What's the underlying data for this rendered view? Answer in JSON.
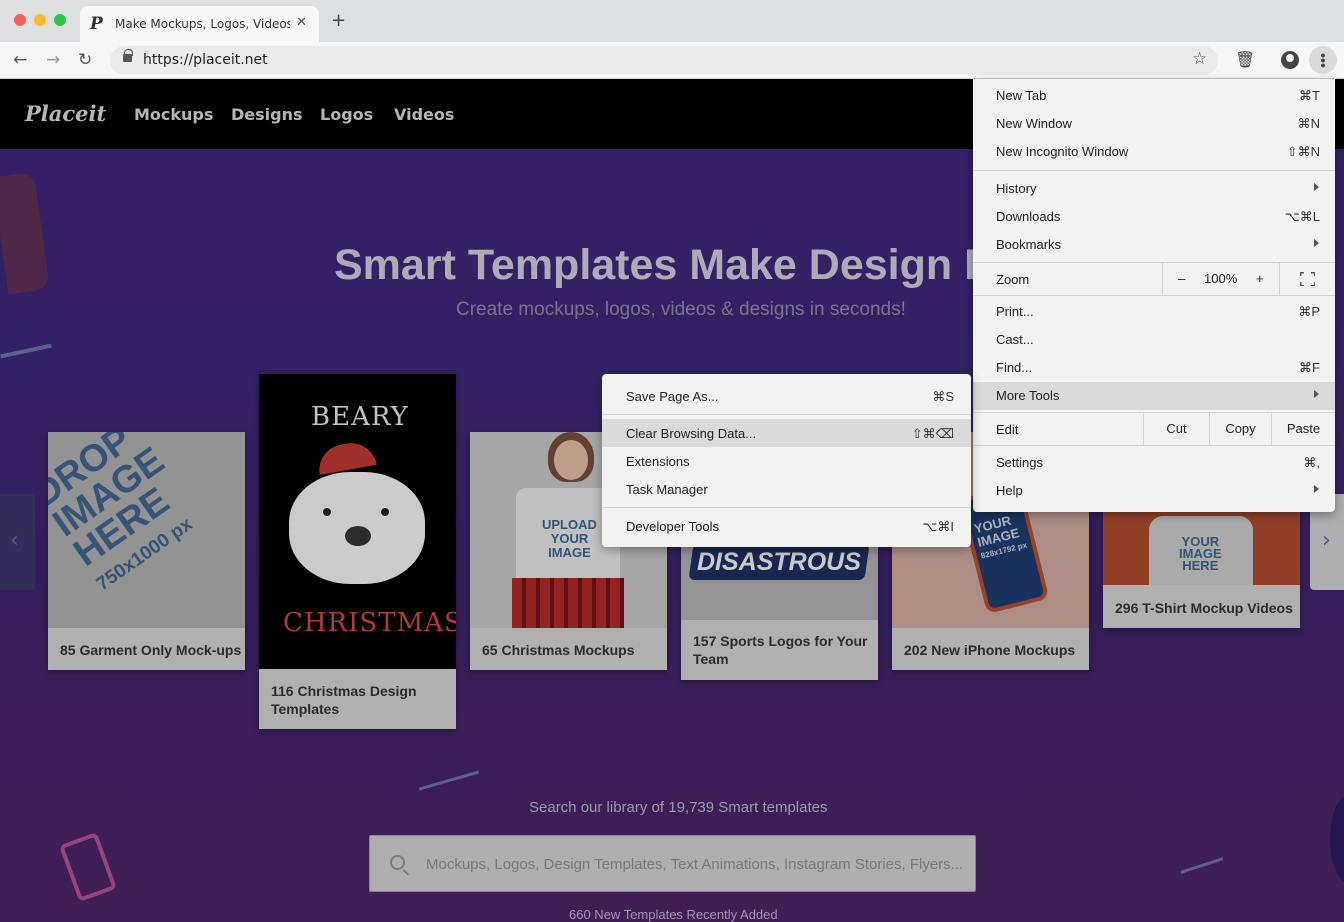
{
  "browser": {
    "tab_title": "Make Mockups, Logos, Videos",
    "tab_favicon": "P",
    "tab_close": "✕",
    "new_tab": "+",
    "url": "https://placeit.net",
    "icons": [
      "back-icon",
      "forward-icon",
      "reload-icon",
      "lock-icon",
      "star-icon",
      "trash-icon",
      "profile-icon",
      "menu-icon"
    ]
  },
  "site": {
    "logo": "Placeit",
    "nav": [
      "Mockups",
      "Designs",
      "Logos",
      "Videos"
    ],
    "hero_title": "Smart Templates Make Design Eas",
    "hero_subtitle": "Create mockups, logos, videos & designs in seconds!",
    "cards": [
      {
        "label": "85 Garment Only Mock-ups",
        "image_text": [
          "DROP",
          "IMAGE",
          "HERE",
          "750x1000 px"
        ]
      },
      {
        "label_line1": "116 Christmas Design",
        "label_line2": "Templates",
        "image_text": [
          "BEARY",
          "CHRISTMAS"
        ]
      },
      {
        "label": "65 Christmas Mockups",
        "image_text": [
          "UPLOAD",
          "YOUR",
          "IMAGE"
        ]
      },
      {
        "label_line1": "157 Sports Logos for Your",
        "label_line2": "Team",
        "image_text": [
          "DISASTROUS"
        ]
      },
      {
        "label": "202 New iPhone Mockups",
        "image_text": [
          "YOUR",
          "IMAGE",
          "828x1792 px"
        ]
      },
      {
        "label": "296 T-Shirt Mockup Videos",
        "image_text": [
          "YOUR",
          "IMAGE",
          "HERE"
        ]
      }
    ],
    "search_label": "Search our library of 19,739 Smart templates",
    "search_placeholder": "Mockups, Logos, Design Templates, Text Animations, Instagram Stories, Flyers...",
    "recent_line": "660  New Templates  Recently Added",
    "arrow_left": "‹",
    "arrow_right": "›"
  },
  "chrome_menu": {
    "new_tab": {
      "label": "New Tab",
      "shortcut": "⌘T"
    },
    "new_window": {
      "label": "New Window",
      "shortcut": "⌘N"
    },
    "new_incognito": {
      "label": "New Incognito Window",
      "shortcut": "⇧⌘N"
    },
    "history": {
      "label": "History"
    },
    "downloads": {
      "label": "Downloads",
      "shortcut": "⌥⌘L"
    },
    "bookmarks": {
      "label": "Bookmarks"
    },
    "zoom": {
      "label": "Zoom",
      "minus": "–",
      "level": "100%",
      "plus": "+"
    },
    "print": {
      "label": "Print...",
      "shortcut": "⌘P"
    },
    "cast": {
      "label": "Cast..."
    },
    "find": {
      "label": "Find...",
      "shortcut": "⌘F"
    },
    "more_tools": {
      "label": "More Tools"
    },
    "edit": {
      "label": "Edit",
      "cut": "Cut",
      "copy": "Copy",
      "paste": "Paste"
    },
    "settings": {
      "label": "Settings",
      "shortcut": "⌘,"
    },
    "help": {
      "label": "Help"
    }
  },
  "more_tools_menu": {
    "save_page": {
      "label": "Save Page As...",
      "shortcut": "⌘S"
    },
    "clear_data": {
      "label": "Clear Browsing Data...",
      "shortcut": "⇧⌘⌫"
    },
    "extensions": {
      "label": "Extensions"
    },
    "task_manager": {
      "label": "Task Manager"
    },
    "dev_tools": {
      "label": "Developer Tools",
      "shortcut": "⌥⌘I"
    }
  }
}
